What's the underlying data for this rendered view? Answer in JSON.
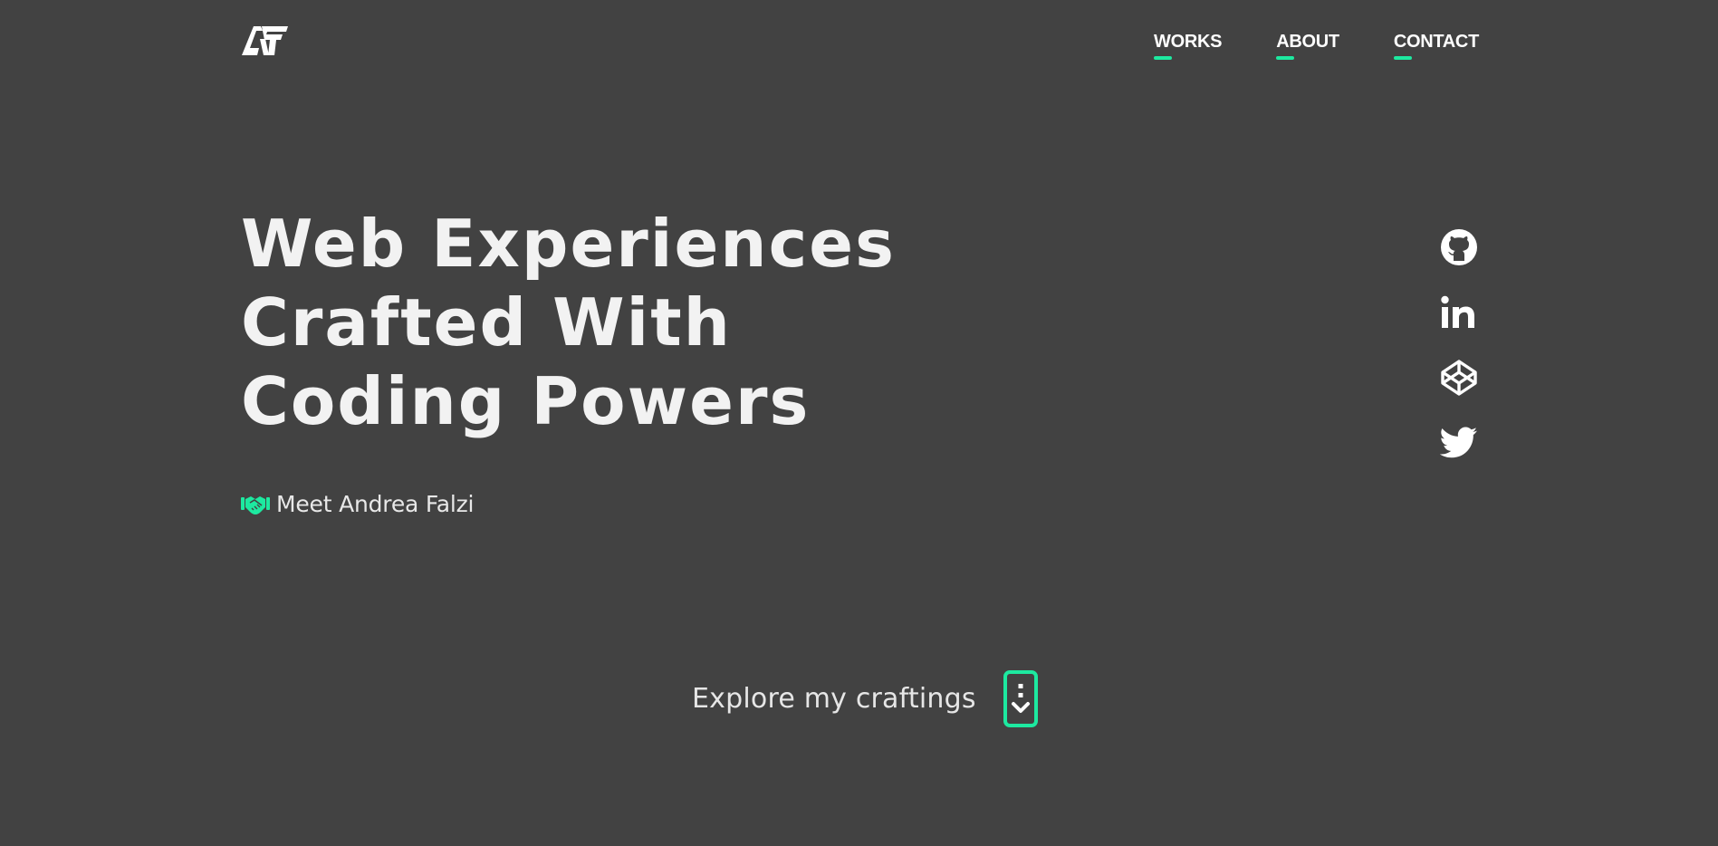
{
  "header": {
    "logo_text": "AF",
    "nav": [
      {
        "label": "WORKS"
      },
      {
        "label": "ABOUT"
      },
      {
        "label": "CONTACT"
      }
    ]
  },
  "hero": {
    "title_lines": [
      "Web Experiences",
      "Crafted With",
      "Coding Powers"
    ],
    "meet": {
      "icon": "handshake-icon",
      "label": "Meet Andrea Falzi"
    }
  },
  "socials": [
    {
      "name": "GitHub",
      "icon": "github-icon"
    },
    {
      "name": "LinkedIn",
      "icon": "linkedin-icon"
    },
    {
      "name": "CodePen",
      "icon": "codepen-icon"
    },
    {
      "name": "Twitter",
      "icon": "twitter-icon"
    }
  ],
  "explore": {
    "label": "Explore my craftings",
    "icon": "scroll-down-icon"
  },
  "colors": {
    "background": "#424242",
    "accent": "#1de9a0",
    "text": "#f2f2f2"
  }
}
